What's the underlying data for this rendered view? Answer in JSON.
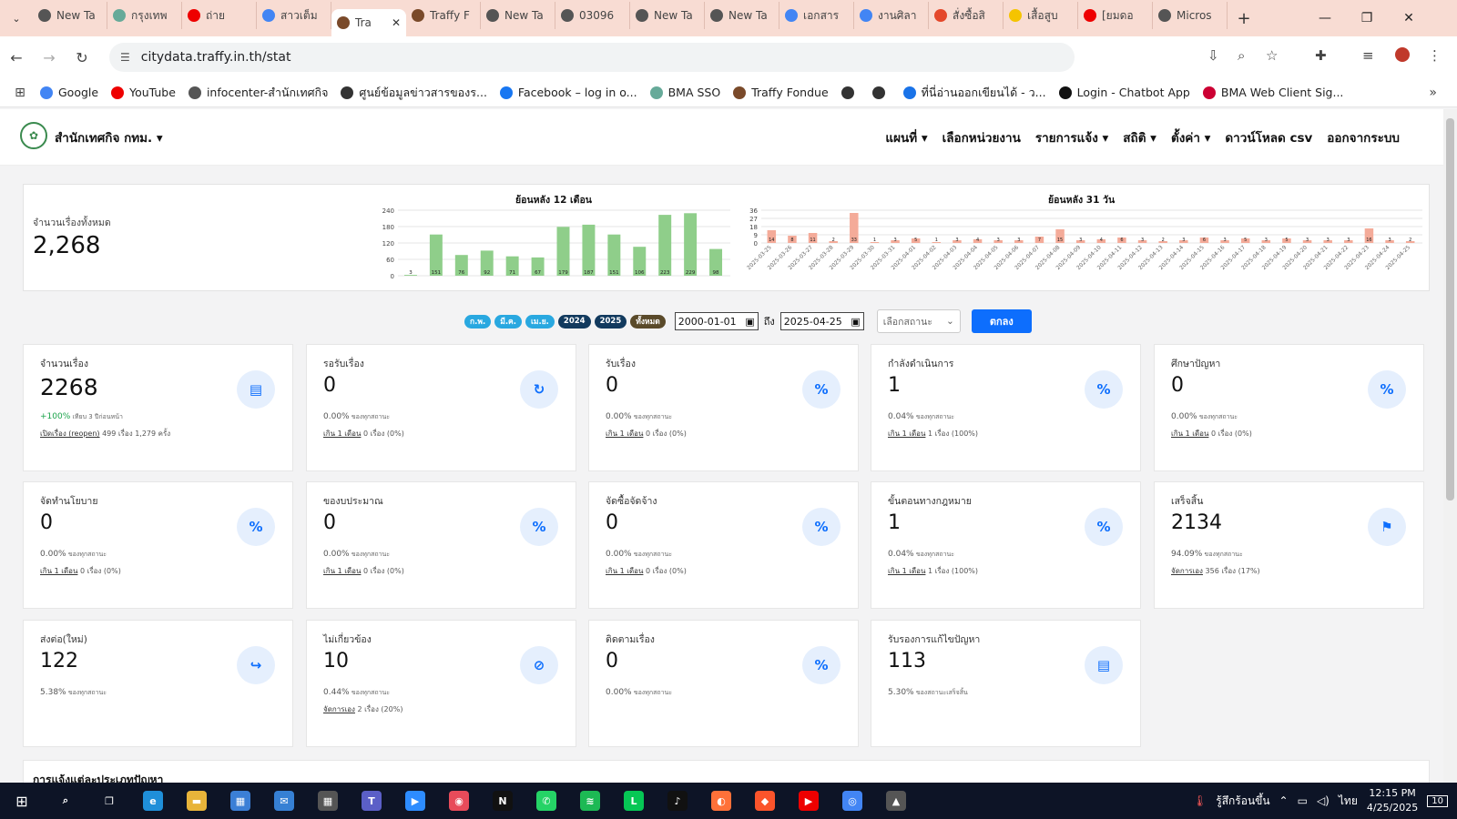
{
  "tabs": [
    {
      "title": "New Ta",
      "color": "#555"
    },
    {
      "title": "กรุงเทพ",
      "color": "#6a9"
    },
    {
      "title": "ถ่าย",
      "color": "#e00"
    },
    {
      "title": "สาวเต็ม",
      "color": "#4285f4"
    },
    {
      "title": "Tra",
      "color": "#7a4a2a",
      "active": true
    },
    {
      "title": "Traffy F",
      "color": "#7a4a2a"
    },
    {
      "title": "New Ta",
      "color": "#555"
    },
    {
      "title": "03096",
      "color": "#555"
    },
    {
      "title": "New Ta",
      "color": "#555"
    },
    {
      "title": "New Ta",
      "color": "#555"
    },
    {
      "title": "เอกสาร",
      "color": "#4285f4"
    },
    {
      "title": "งานศิลา",
      "color": "#4285f4"
    },
    {
      "title": "สั่งซื้อสิ",
      "color": "#e4472a"
    },
    {
      "title": "เสื้อสูบ",
      "color": "#f5c400"
    },
    {
      "title": "[ยมดอ",
      "color": "#e00"
    },
    {
      "title": "Micros",
      "color": "#555"
    }
  ],
  "address": {
    "url": "citydata.traffy.in.th/stat"
  },
  "bookmarks": [
    {
      "label": "Google",
      "color": "#4285f4"
    },
    {
      "label": "YouTube",
      "color": "#e00"
    },
    {
      "label": "infocenter-สำนักเทศกิจ",
      "color": "#555"
    },
    {
      "label": "ศูนย์ข้อมูลข่าวสารของร...",
      "color": "#333"
    },
    {
      "label": "Facebook – log in o...",
      "color": "#1877f2"
    },
    {
      "label": "BMA SSO",
      "color": "#6a9"
    },
    {
      "label": "Traffy Fondue",
      "color": "#7a4a2a"
    },
    {
      "label": "",
      "color": "#333"
    },
    {
      "label": "",
      "color": "#333"
    },
    {
      "label": "ที่นี่อ่านออกเขียนได้ - ว...",
      "color": "#1a73e8"
    },
    {
      "label": "Login - Chatbot App",
      "color": "#111"
    },
    {
      "label": "BMA Web Client Sig...",
      "color": "#c03"
    }
  ],
  "org": "สำนักเทศกิจ กทม.",
  "menu": [
    "แผนที่ ▾",
    "เลือกหน่วยงาน",
    "รายการแจ้ง ▾",
    "สถิติ ▾",
    "ตั้งค่า ▾",
    "ดาวน์โหลด csv",
    "ออกจากระบบ"
  ],
  "summary": {
    "label": "จำนวนเรื่องทั้งหมด",
    "value": "2,268"
  },
  "chart_data": [
    {
      "type": "bar",
      "title": "ย้อนหลัง 12 เดือน",
      "yticks": [
        0,
        60,
        120,
        180,
        240
      ],
      "ylim": [
        0,
        240
      ],
      "values": [
        3,
        151,
        76,
        92,
        71,
        67,
        179,
        187,
        151,
        106,
        223,
        229,
        98
      ],
      "labels": [
        "3",
        "151",
        "76",
        "92",
        "71",
        "67",
        "179",
        "187",
        "151",
        "106",
        "223",
        "229",
        "98"
      ],
      "color": "#8fce8a"
    },
    {
      "type": "bar",
      "title": "ย้อนหลัง 31 วัน",
      "yticks": [
        0,
        9,
        18,
        27,
        36
      ],
      "ylim": [
        0,
        36
      ],
      "categories": [
        "2025-03-25",
        "2025-03-26",
        "2025-03-27",
        "2025-03-28",
        "2025-03-29",
        "2025-03-30",
        "2025-03-31",
        "2025-04-01",
        "2025-04-02",
        "2025-04-03",
        "2025-04-04",
        "2025-04-05",
        "2025-04-06",
        "2025-04-07",
        "2025-04-08",
        "2025-04-09",
        "2025-04-10",
        "2025-04-11",
        "2025-04-12",
        "2025-04-13",
        "2025-04-14",
        "2025-04-15",
        "2025-04-16",
        "2025-04-17",
        "2025-04-18",
        "2025-04-19",
        "2025-04-20",
        "2025-04-21",
        "2025-04-22",
        "2025-04-23",
        "2025-04-24",
        "2025-04-25"
      ],
      "values": [
        14,
        8,
        11,
        2,
        33,
        1,
        3,
        5,
        1,
        3,
        4,
        3,
        3,
        7,
        15,
        3,
        4,
        6,
        3,
        2,
        3,
        6,
        3,
        5,
        3,
        5,
        3,
        3,
        3,
        16,
        3,
        2
      ],
      "color": "#f4ab99"
    }
  ],
  "filters": {
    "pills": [
      {
        "label": "ก.พ.",
        "color": "#29a8e0"
      },
      {
        "label": "มี.ค.",
        "color": "#29a8e0"
      },
      {
        "label": "เม.ย.",
        "color": "#29a8e0"
      },
      {
        "label": "2024",
        "color": "#123a5e"
      },
      {
        "label": "2025",
        "color": "#123a5e"
      },
      {
        "label": "ทั้งหมด",
        "color": "#5a4a2a"
      }
    ],
    "from": "2000-01-01",
    "to_label": "ถึง",
    "to": "2025-04-25",
    "status_placeholder": "เลือกสถานะ",
    "submit": "ตกลง"
  },
  "cards": [
    {
      "label": "จำนวนเรื่อง",
      "value": "2268",
      "big": true,
      "sub1_green": "+100%",
      "sub1": " เทียบ 3 ปีก่อนหน้า",
      "sub2_link": "เปิดเรื่อง (reopen)",
      "sub2": " 499 เรื่อง 1,279 ครั้ง",
      "icon": "▤",
      "icon_name": "document-icon"
    },
    {
      "label": "รอรับเรื่อง",
      "value": "0",
      "sub1": "0.00%",
      "sub1_s": " ของทุกสถานะ",
      "sub2_link": "เกิน 1 เดือน",
      "sub2": " 0 เรื่อง (0%)",
      "icon": "↻",
      "icon_name": "refresh-icon"
    },
    {
      "label": "รับเรื่อง",
      "value": "0",
      "sub1": "0.00%",
      "sub1_s": " ของทุกสถานะ",
      "sub2_link": "เกิน 1 เดือน",
      "sub2": " 0 เรื่อง (0%)",
      "icon": "%",
      "icon_name": "percent-icon"
    },
    {
      "label": "กำลังดำเนินการ",
      "value": "1",
      "sub1": "0.04%",
      "sub1_s": " ของทุกสถานะ",
      "sub2_link": "เกิน 1 เดือน",
      "sub2": " 1 เรื่อง (100%)",
      "icon": "%",
      "icon_name": "percent-icon"
    },
    {
      "label": "ศึกษาปัญหา",
      "value": "0",
      "sub1": "0.00%",
      "sub1_s": " ของทุกสถานะ",
      "sub2_link": "เกิน 1 เดือน",
      "sub2": " 0 เรื่อง (0%)",
      "icon": "%",
      "icon_name": "percent-icon"
    },
    {
      "label": "จัดทำนโยบาย",
      "value": "0",
      "sub1": "0.00%",
      "sub1_s": " ของทุกสถานะ",
      "sub2_link": "เกิน 1 เดือน",
      "sub2": " 0 เรื่อง (0%)",
      "icon": "%",
      "icon_name": "percent-icon"
    },
    {
      "label": "ของบประมาณ",
      "value": "0",
      "sub1": "0.00%",
      "sub1_s": " ของทุกสถานะ",
      "sub2_link": "เกิน 1 เดือน",
      "sub2": " 0 เรื่อง (0%)",
      "icon": "%",
      "icon_name": "percent-icon"
    },
    {
      "label": "จัดซื้อจัดจ้าง",
      "value": "0",
      "sub1": "0.00%",
      "sub1_s": " ของทุกสถานะ",
      "sub2_link": "เกิน 1 เดือน",
      "sub2": " 0 เรื่อง (0%)",
      "icon": "%",
      "icon_name": "percent-icon"
    },
    {
      "label": "ขั้นตอนทางกฎหมาย",
      "value": "1",
      "sub1": "0.04%",
      "sub1_s": " ของทุกสถานะ",
      "sub2_link": "เกิน 1 เดือน",
      "sub2": " 1 เรื่อง (100%)",
      "icon": "%",
      "icon_name": "percent-icon"
    },
    {
      "label": "เสร็จสิ้น",
      "value": "2134",
      "sub1": "94.09%",
      "sub1_s": " ของทุกสถานะ",
      "sub2_link": "จัดการเอง",
      "sub2": " 356 เรื่อง (17%)",
      "icon": "⚑",
      "icon_name": "checkered-flag-icon"
    },
    {
      "label": "ส่งต่อ(ใหม่)",
      "value": "122",
      "sub1": "5.38%",
      "sub1_s": " ของทุกสถานะ",
      "sub2_link": "",
      "sub2": "",
      "icon": "↪",
      "icon_name": "forward-icon"
    },
    {
      "label": "ไม่เกี่ยวข้อง",
      "value": "10",
      "sub1": "0.44%",
      "sub1_s": " ของทุกสถานะ",
      "sub2_link": "จัดการเอง",
      "sub2": " 2 เรื่อง (20%)",
      "icon": "⊘",
      "icon_name": "unrelated-icon"
    },
    {
      "label": "ติดตามเรื่อง",
      "value": "0",
      "sub1": "0.00%",
      "sub1_s": " ของทุกสถานะ",
      "sub2_link": "",
      "sub2": "",
      "icon": "%",
      "icon_name": "percent-icon"
    },
    {
      "label": "รับรองการแก้ไขปัญหา",
      "value": "113",
      "sub1": "5.30%",
      "sub1_s": " ของสถานะเสร็จสิ้น",
      "sub2_link": "",
      "sub2": "",
      "icon": "▤",
      "icon_name": "document-icon"
    }
  ],
  "section_title": "การแจ้งแต่ละประเภทปัญหา",
  "taskbar": [
    {
      "icon": "search-icon",
      "glyph": "⌕",
      "color": "transparent"
    },
    {
      "icon": "task-view-icon",
      "glyph": "❐",
      "color": "transparent"
    },
    {
      "icon": "edge-icon",
      "glyph": "e",
      "color": "#1f8fd9"
    },
    {
      "icon": "file-explorer-icon",
      "glyph": "▬",
      "color": "#e8b43a"
    },
    {
      "icon": "store-icon",
      "glyph": "▦",
      "color": "#3b7fd6"
    },
    {
      "icon": "mail-icon",
      "glyph": "✉",
      "color": "#3680d4"
    },
    {
      "icon": "calculator-icon",
      "glyph": "▦",
      "color": "#555"
    },
    {
      "icon": "teams-icon",
      "glyph": "T",
      "color": "#5b5fc7"
    },
    {
      "icon": "zoom-icon",
      "glyph": "▶",
      "color": "#2d8cff"
    },
    {
      "icon": "app-icon",
      "glyph": "◉",
      "color": "#e84b5a"
    },
    {
      "icon": "netflix-icon",
      "glyph": "N",
      "color": "#111"
    },
    {
      "icon": "whatsapp-icon",
      "glyph": "✆",
      "color": "#25d366"
    },
    {
      "icon": "spotify-icon",
      "glyph": "≋",
      "color": "#1db954"
    },
    {
      "icon": "line-icon",
      "glyph": "L",
      "color": "#06c755"
    },
    {
      "icon": "tiktok-icon",
      "glyph": "♪",
      "color": "#111"
    },
    {
      "icon": "firefox-icon",
      "glyph": "◐",
      "color": "#ff7139"
    },
    {
      "icon": "brave-icon",
      "glyph": "◆",
      "color": "#fb542b"
    },
    {
      "icon": "youtube-icon",
      "glyph": "▶",
      "color": "#e00"
    },
    {
      "icon": "chrome-icon",
      "glyph": "◎",
      "color": "#4285f4"
    },
    {
      "icon": "photos-icon",
      "glyph": "▲",
      "color": "#555"
    }
  ],
  "tray": {
    "weather": "รู้สึกร้อนขึ้น",
    "lang": "ไทย",
    "time": "12:15 PM",
    "date": "4/25/2025",
    "notif": "10"
  }
}
